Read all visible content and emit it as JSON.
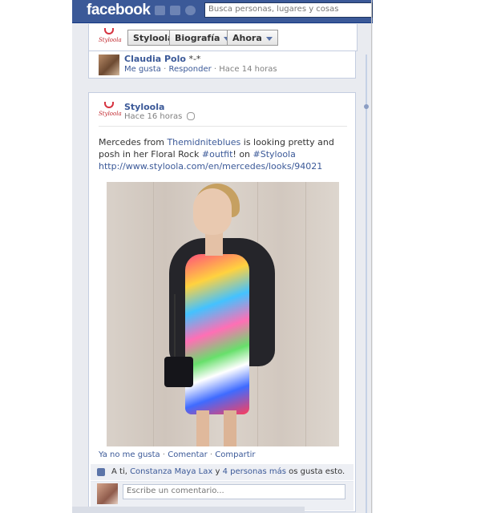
{
  "topbar": {
    "logo": "facebook",
    "search_placeholder": "Busca personas, lugares y cosas",
    "icons": [
      "friend-requests-icon",
      "messages-icon",
      "notifications-icon"
    ]
  },
  "page_header": {
    "logo_text": "Styloola",
    "nav": [
      "Styloola",
      "Biografía",
      "Ahora"
    ]
  },
  "comment": {
    "author": "Claudia Polo",
    "text": "*-*",
    "like": "Me gusta",
    "reply": "Responder",
    "time": "Hace 14 horas"
  },
  "post": {
    "author": "Styloola",
    "time": "Hace 16 horas",
    "text_prefix": "Mercedes from ",
    "mention": "Themidniteblues",
    "text_mid": " is looking pretty and posh in her Floral Rock ",
    "hashtag1": "#outfit",
    "text_mid2": "! on ",
    "hashtag2": "#Styloola",
    "url": "http://www.styloola.com/en/mercedes/looks/94021",
    "actions": [
      "Ya no me gusta",
      "Comentar",
      "Compartir"
    ],
    "likes_prefix": "A ti, ",
    "likes_person": "Constanza Maya Lax",
    "likes_mid": " y ",
    "likes_others": "4 personas más",
    "likes_suffix": " os gusta esto.",
    "comment_placeholder": "Escribe un comentario..."
  },
  "colors": {
    "brand_blue": "#3b5998",
    "link": "#3b5998",
    "logo_red": "#d63340"
  }
}
